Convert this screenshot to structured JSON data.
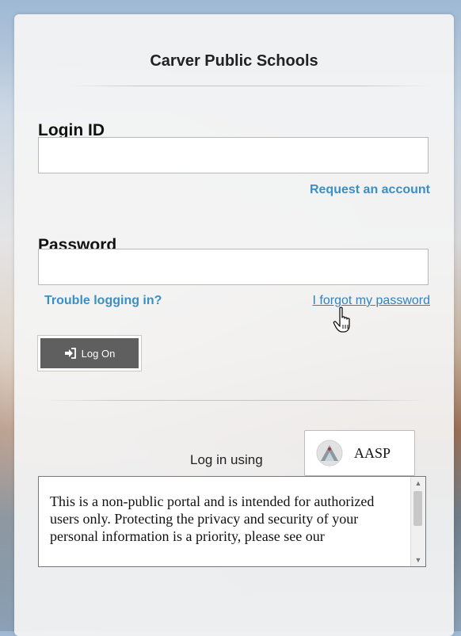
{
  "header": {
    "title": "Carver Public Schools"
  },
  "login": {
    "label": "Login ID",
    "value": "",
    "request_link": "Request an account"
  },
  "password": {
    "label": "Password",
    "value": "",
    "trouble_link": "Trouble logging in?",
    "forgot_link": "I forgot my password"
  },
  "actions": {
    "logon_label": "Log On",
    "logon_icon": "sign-in-icon"
  },
  "sso": {
    "prompt": "Log in using",
    "provider_label": "AASP",
    "provider_icon": "aasp-logo-icon"
  },
  "notice": {
    "text": "This is a non-public portal and is intended for authorized users only. Protecting the privacy and security of your personal information is a priority, please see our"
  },
  "colors": {
    "link": "#3b8fc4",
    "button_bg": "#5f5f5f"
  }
}
